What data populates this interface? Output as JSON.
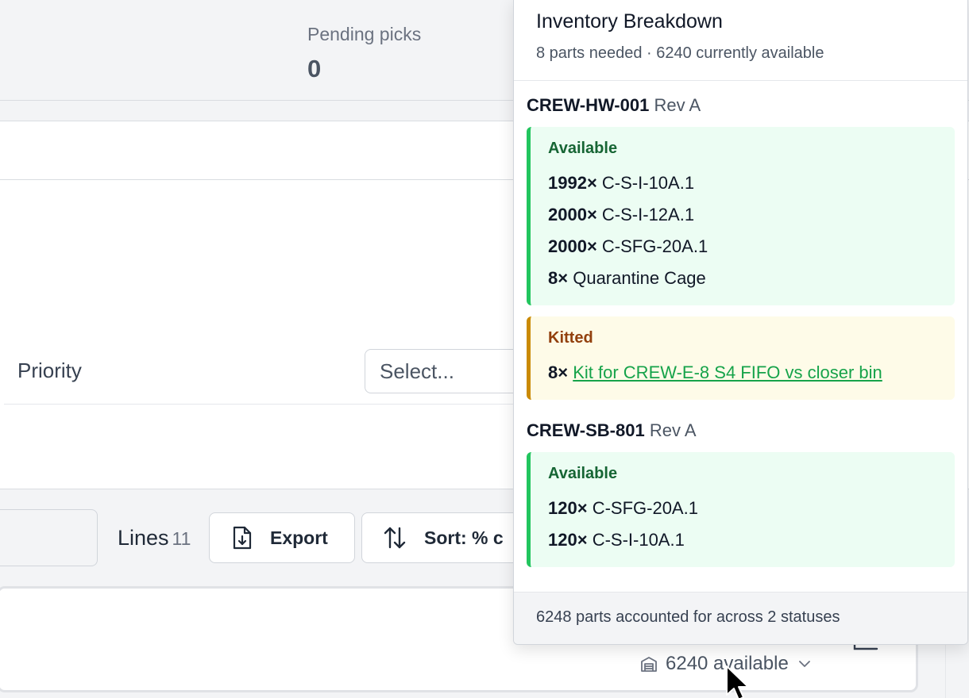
{
  "stats": {
    "pending_label": "Pending picks",
    "pending_value": "0"
  },
  "form": {
    "priority_label": "Priority",
    "priority_placeholder": "Select..."
  },
  "toolbar": {
    "lines_label": "Lines",
    "lines_count": "11",
    "export_label": "Export",
    "sort_label": "Sort: % c"
  },
  "row_card": {
    "available_text": "6240 available"
  },
  "popover": {
    "title": "Inventory Breakdown",
    "subtitle": "8 parts needed · 6240 currently available",
    "parts": [
      {
        "part_number": "CREW-HW-001",
        "rev": "Rev A",
        "available_label": "Available",
        "available": [
          {
            "qty": "1992×",
            "location": "C-S-I-10A.1"
          },
          {
            "qty": "2000×",
            "location": "C-S-I-12A.1"
          },
          {
            "qty": "2000×",
            "location": "C-SFG-20A.1"
          },
          {
            "qty": "8×",
            "location": "Quarantine Cage"
          }
        ],
        "kitted_label": "Kitted",
        "kitted": [
          {
            "qty": "8×",
            "link": "Kit for CREW-E-8 S4 FIFO vs closer bin"
          }
        ]
      },
      {
        "part_number": "CREW-SB-801",
        "rev": "Rev A",
        "available_label": "Available",
        "available": [
          {
            "qty": "120×",
            "location": "C-SFG-20A.1"
          },
          {
            "qty": "120×",
            "location": "C-S-I-10A.1"
          }
        ]
      }
    ],
    "footer": "6248 parts accounted for across 2 statuses"
  },
  "colors": {
    "available_accent": "#22c55e",
    "kitted_accent": "#ca8a04",
    "link": "#16a34a"
  }
}
